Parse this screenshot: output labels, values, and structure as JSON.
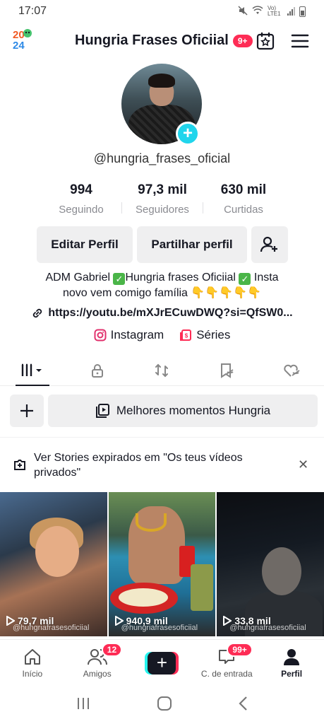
{
  "status_bar": {
    "time": "17:07",
    "network": "Vo) LTE1"
  },
  "header": {
    "logo_year_top": "20",
    "logo_year_bottom": "24",
    "profile_name": "Hungria Frases Oficiial",
    "notif_badge": "9+"
  },
  "profile": {
    "handle": "@hungria_frases_oficial"
  },
  "stats": [
    {
      "value": "994",
      "label": "Seguindo"
    },
    {
      "value": "97,3 mil",
      "label": "Seguidores"
    },
    {
      "value": "630 mil",
      "label": "Curtidas"
    }
  ],
  "buttons": {
    "edit_profile": "Editar Perfil",
    "share_profile": "Partilhar perfil"
  },
  "bio": {
    "part1": "ADM Gabriel ",
    "part2": "Hungria frases Oficiial ",
    "part3": " Insta",
    "line2": "novo vem comigo família 👇👇👇👇👇",
    "link": "https://youtu.be/mXJrECuwDWQ?si=QfSW0..."
  },
  "social": {
    "instagram": "Instagram",
    "series": "Séries"
  },
  "collection": {
    "highlight_label": "Melhores momentos Hungria"
  },
  "stories_banner": {
    "text": "Ver Stories expirados em \"Os teus vídeos privados\""
  },
  "videos": [
    {
      "views": "79,7 mil",
      "watermark": "@hungriafrasesoficiial"
    },
    {
      "views": "940,9 mil",
      "watermark": "@hungriafrasesoficiial"
    },
    {
      "views": "33,8 mil",
      "watermark": "@hungriafrasesoficiial"
    }
  ],
  "bottom_nav": {
    "home": "Início",
    "friends": "Amigos",
    "friends_badge": "12",
    "inbox": "C. de entrada",
    "inbox_badge": "99+",
    "profile": "Perfil"
  },
  "colors": {
    "accent": "#fe2c55",
    "cyan": "#20d5ec",
    "text": "#161823",
    "muted": "#8a8b91",
    "button_bg": "#efeff0"
  }
}
